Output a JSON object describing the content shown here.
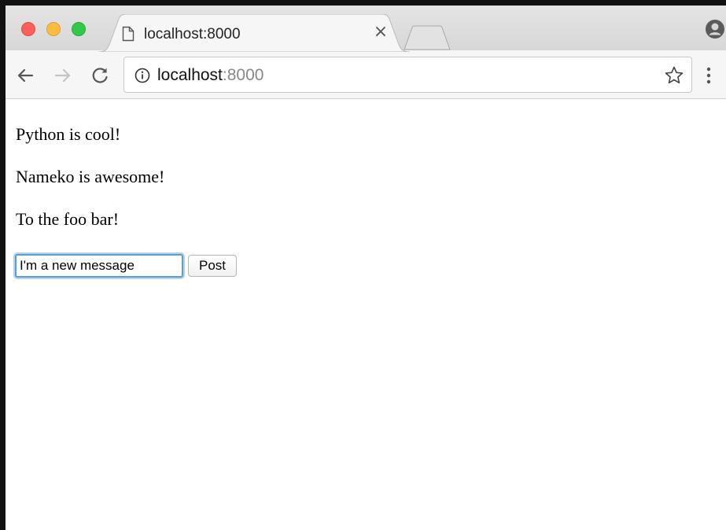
{
  "browser": {
    "tab": {
      "title": "localhost:8000",
      "close_glyph": "×",
      "icon": "page-icon"
    },
    "url": {
      "host": "localhost",
      "port": ":8000"
    },
    "icons": {
      "back": "arrow-left-icon",
      "forward": "arrow-right-icon",
      "reload": "reload-icon",
      "info": "info-icon",
      "bookmark": "star-icon",
      "menu": "kebab-menu-icon",
      "profile": "profile-icon"
    },
    "traffic_lights": {
      "close": "#fc605c",
      "minimize": "#fdbc40",
      "zoom": "#34c84a"
    }
  },
  "page": {
    "messages": [
      "Python is cool!",
      "Nameko is awesome!",
      "To the foo bar!"
    ],
    "form": {
      "input_value": "I'm a new message",
      "submit_label": "Post"
    }
  },
  "colors": {
    "focus_ring": "#5b9dd9",
    "tab_bar": "#d7d7d7",
    "toolbar": "#f6f6f6"
  }
}
